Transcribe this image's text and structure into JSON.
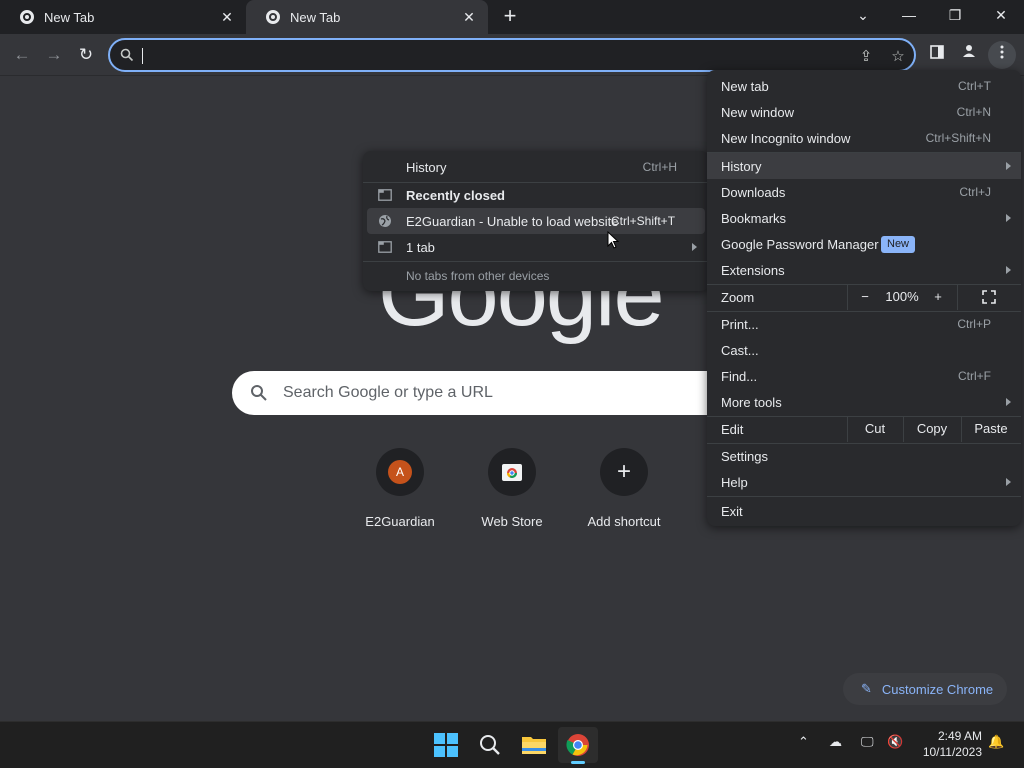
{
  "tabs": [
    {
      "title": "New Tab"
    },
    {
      "title": "New Tab"
    }
  ],
  "omnibox": {
    "value": ""
  },
  "ntp": {
    "logo": "Google",
    "search_placeholder": "Search Google or type a URL",
    "shortcuts": [
      {
        "label": "E2Guardian",
        "letter": "A"
      },
      {
        "label": "Web Store"
      },
      {
        "label": "Add shortcut"
      }
    ],
    "customize_label": "Customize Chrome"
  },
  "main_menu": {
    "new_tab": {
      "label": "New tab",
      "shortcut": "Ctrl+T"
    },
    "new_window": {
      "label": "New window",
      "shortcut": "Ctrl+N"
    },
    "new_incognito": {
      "label": "New Incognito window",
      "shortcut": "Ctrl+Shift+N"
    },
    "history": {
      "label": "History"
    },
    "downloads": {
      "label": "Downloads",
      "shortcut": "Ctrl+J"
    },
    "bookmarks": {
      "label": "Bookmarks"
    },
    "password_manager": {
      "label": "Google Password Manager",
      "badge": "New"
    },
    "extensions": {
      "label": "Extensions"
    },
    "zoom": {
      "label": "Zoom",
      "minus": "−",
      "level": "100%",
      "plus": "+"
    },
    "print": {
      "label": "Print...",
      "shortcut": "Ctrl+P"
    },
    "cast": {
      "label": "Cast..."
    },
    "find": {
      "label": "Find...",
      "shortcut": "Ctrl+F"
    },
    "more_tools": {
      "label": "More tools"
    },
    "edit": {
      "label": "Edit",
      "cut": "Cut",
      "copy": "Copy",
      "paste": "Paste"
    },
    "settings": {
      "label": "Settings"
    },
    "help": {
      "label": "Help"
    },
    "exit": {
      "label": "Exit"
    }
  },
  "history_menu": {
    "history": {
      "label": "History",
      "shortcut": "Ctrl+H"
    },
    "recently_closed": {
      "label": "Recently closed"
    },
    "e2guardian": {
      "label": "E2Guardian - Unable to load website",
      "shortcut": "Ctrl+Shift+T"
    },
    "one_tab": {
      "label": "1 tab"
    },
    "no_tabs": {
      "label": "No tabs from other devices"
    }
  },
  "taskbar": {
    "time": "2:49 AM",
    "date": "10/11/2023"
  },
  "colors": {
    "page_bg": "#35363a",
    "menu_bg": "#292a2d",
    "accent": "#8ab4f8",
    "taskbar_bg": "#202020"
  }
}
